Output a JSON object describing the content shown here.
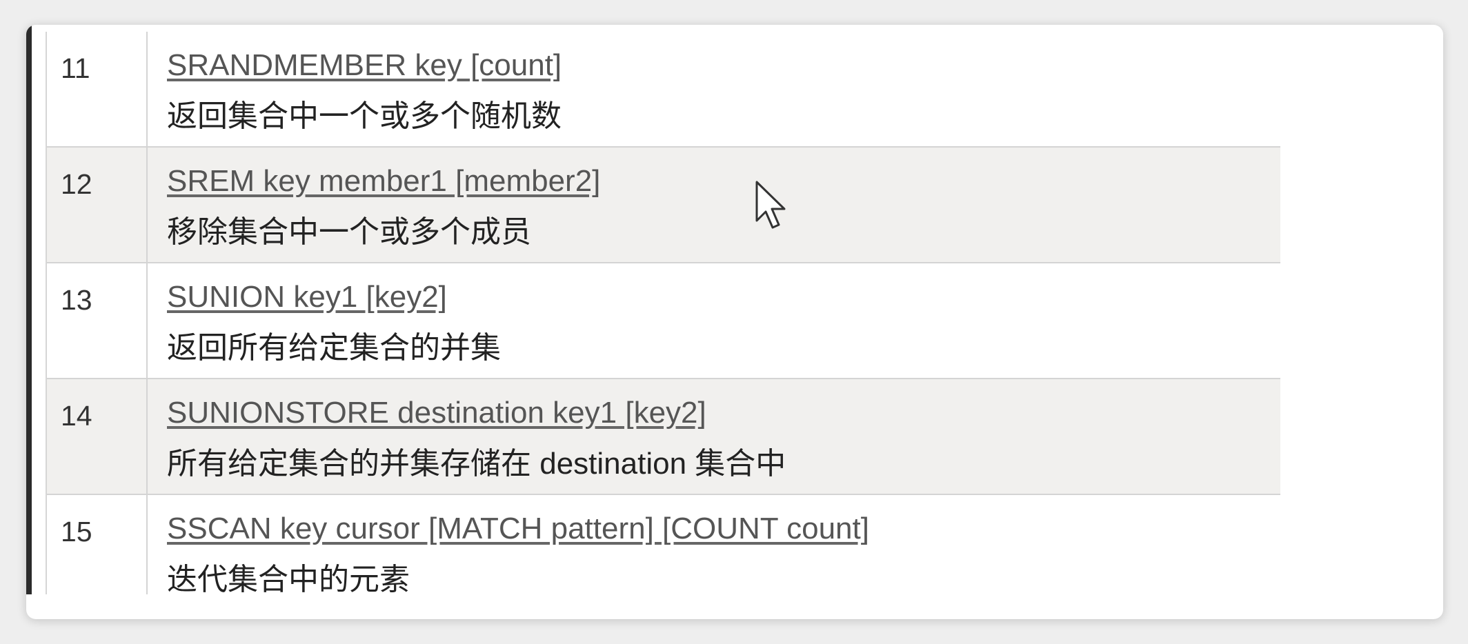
{
  "table": {
    "rows": [
      {
        "num": "11",
        "command": "SRANDMEMBER key [count]",
        "description": "返回集合中一个或多个随机数"
      },
      {
        "num": "12",
        "command": "SREM key member1 [member2]",
        "description": "移除集合中一个或多个成员"
      },
      {
        "num": "13",
        "command": "SUNION key1 [key2]",
        "description": "返回所有给定集合的并集"
      },
      {
        "num": "14",
        "command": "SUNIONSTORE destination key1 [key2]",
        "description": "所有给定集合的并集存储在 destination 集合中"
      },
      {
        "num": "15",
        "command": "SSCAN key cursor [MATCH pattern] [COUNT count]",
        "description": "迭代集合中的元素"
      }
    ]
  },
  "colors": {
    "stripe": "#f1f0ee",
    "link": "#555555",
    "border": "#d4d4d4"
  },
  "icons": {
    "pointer": "mouse-pointer-icon"
  }
}
